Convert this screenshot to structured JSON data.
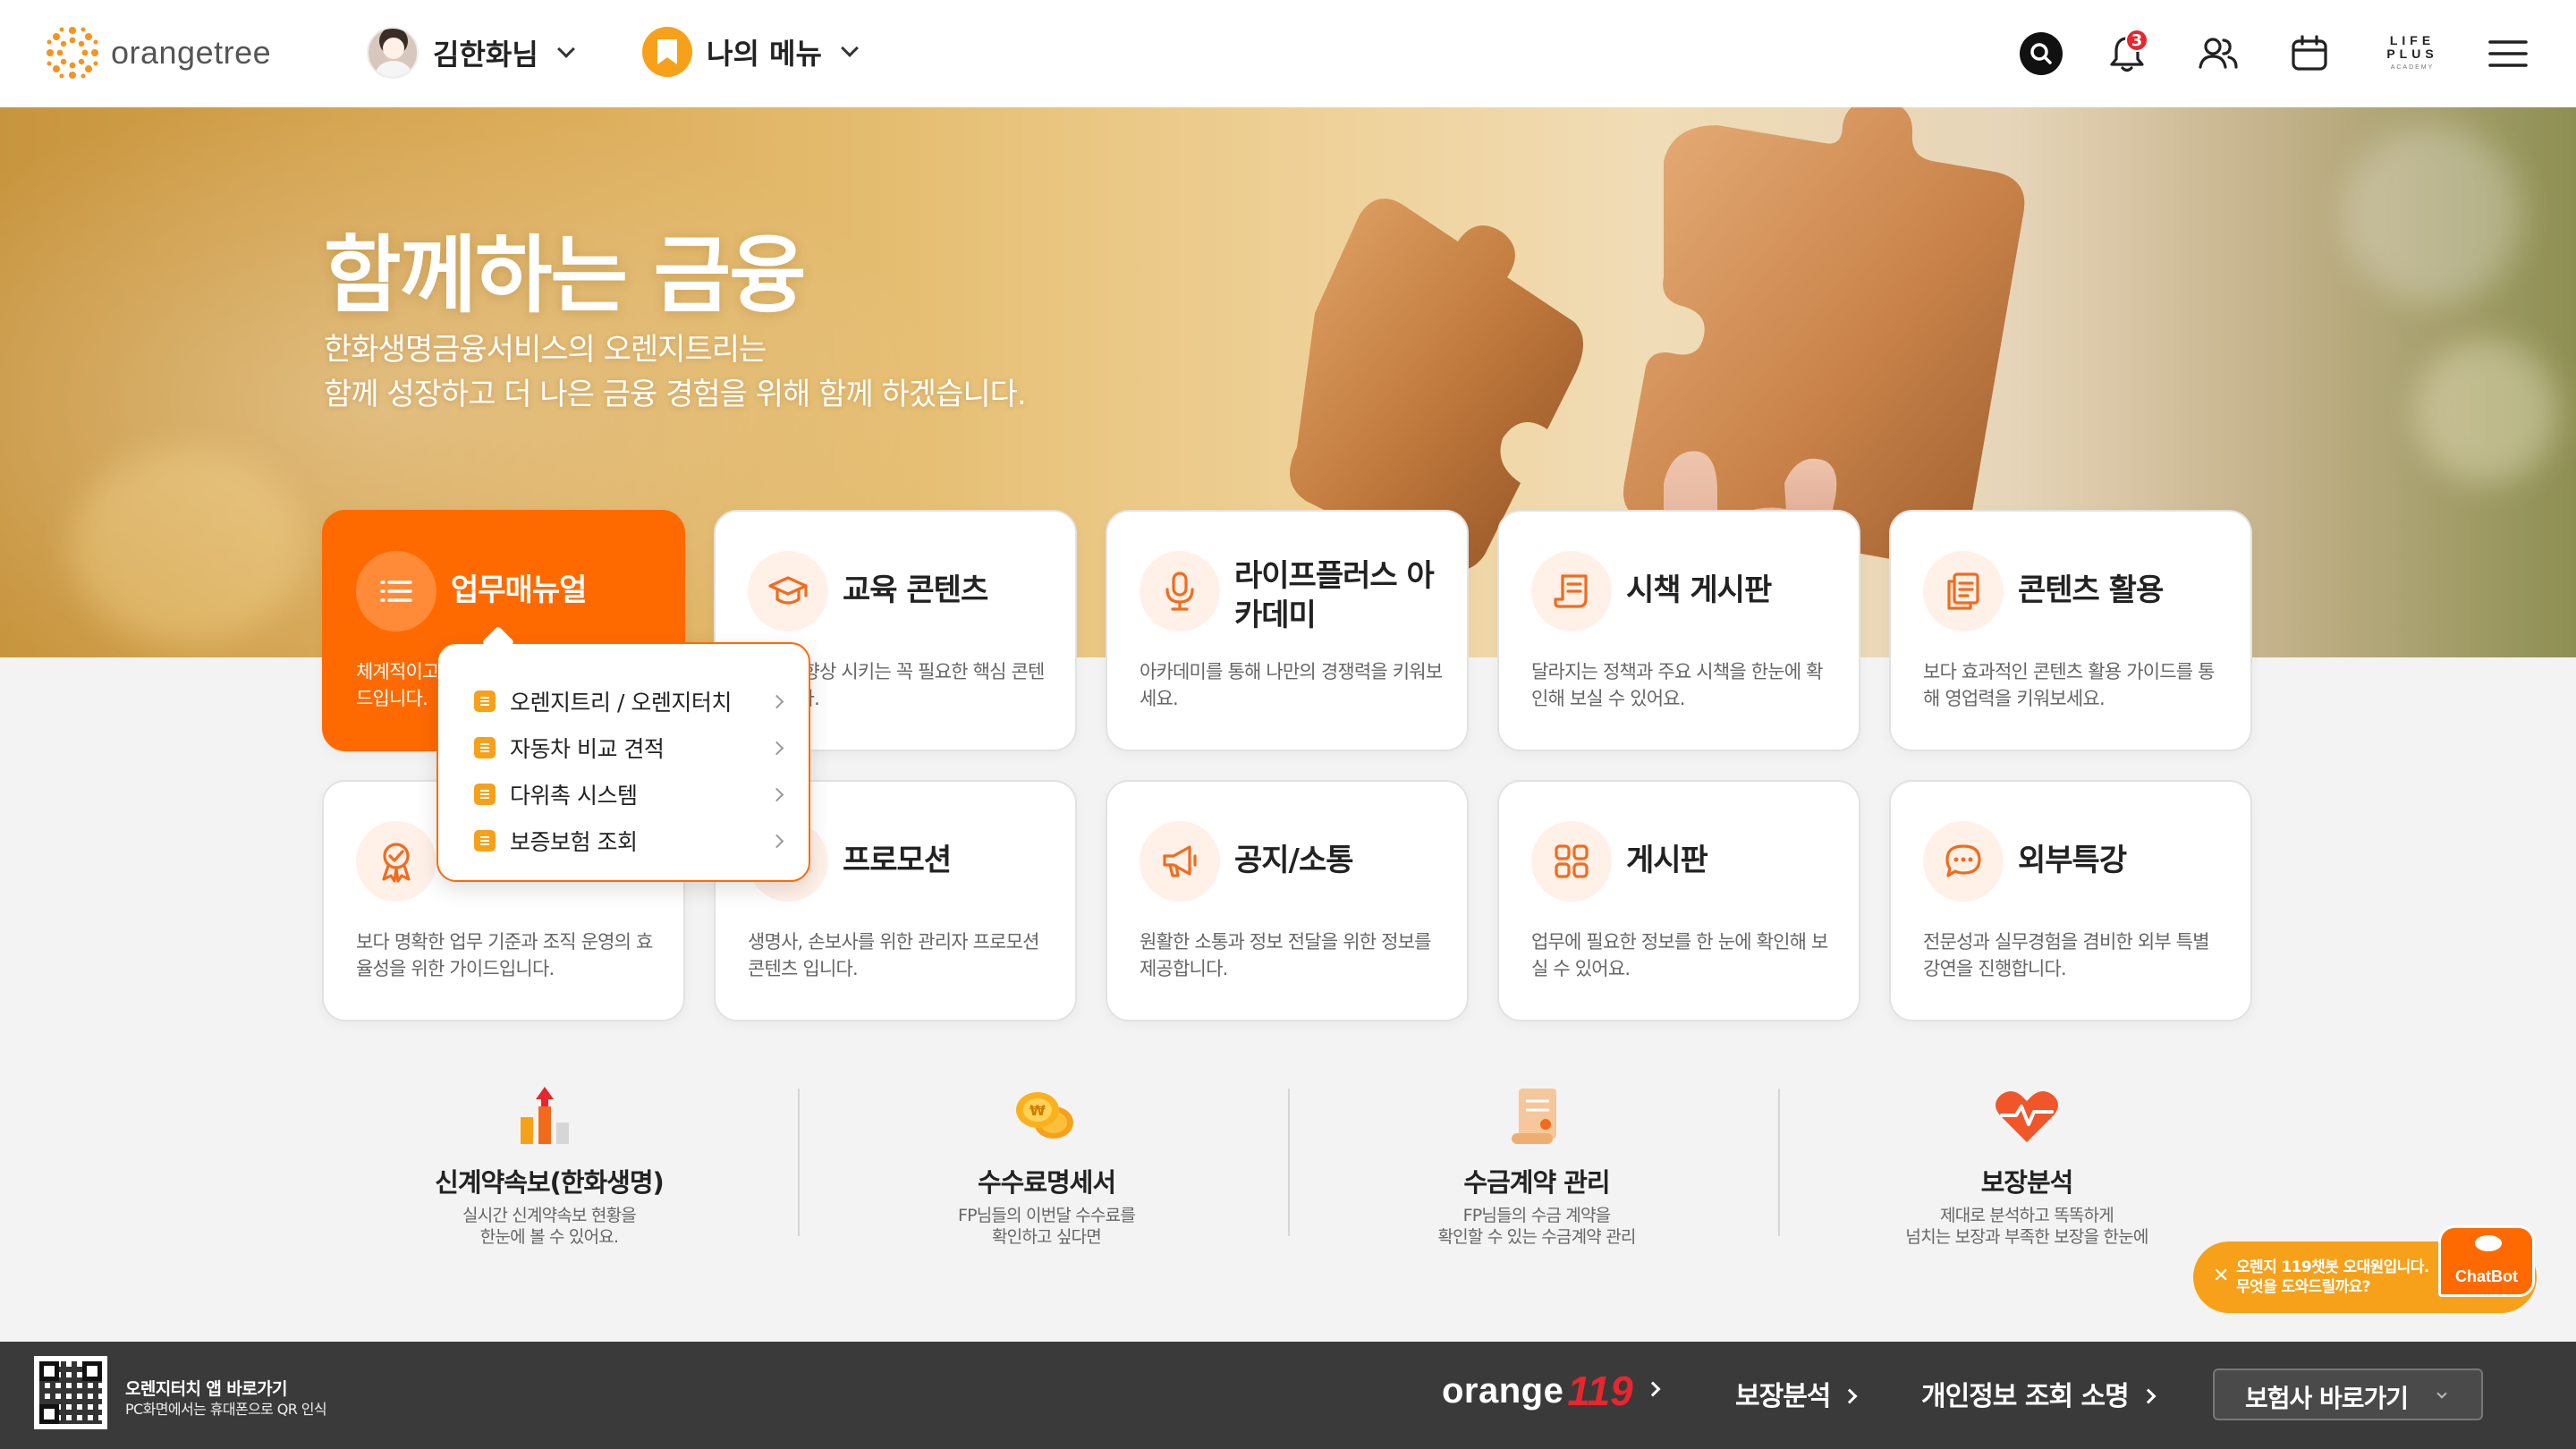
{
  "header": {
    "logo_text": "orangetree",
    "user_name": "김한화님",
    "my_menu_label": "나의 메뉴",
    "notification_count": "3",
    "lifeplus_line1": "LIFE",
    "lifeplus_line2": "PLUS",
    "lifeplus_line3": "ACADEMY",
    "icons": [
      "search-icon",
      "bell-icon",
      "users-icon",
      "calendar-icon",
      "lifeplus-logo",
      "hamburger-menu-icon"
    ]
  },
  "hero": {
    "title": "함께하는 금융",
    "subtitle_line1": "한화생명금융서비스의 오렌지트리는",
    "subtitle_line2": "함께 성장하고 더 나은 금융 경험을 위해 함께 하겠습니다."
  },
  "cards": [
    {
      "title": "업무매뉴얼",
      "desc": "체계적이고 명확한 업무를 위한 실용가이드입니다.",
      "icon": "list-icon",
      "active": true
    },
    {
      "title": "교육 콘텐츠",
      "desc": "역량을 향상 시키는 꼭 필요한 핵심 콘텐츠입니다.",
      "icon": "graduation-cap-icon"
    },
    {
      "title": "라이프플러스 아카데미",
      "desc": "아카데미를 통해 나만의 경쟁력을 키워보세요.",
      "icon": "microphone-icon"
    },
    {
      "title": "시책 게시판",
      "desc": "달라지는 정책과 주요 시책을 한눈에 확인해 보실 수 있어요.",
      "icon": "scroll-icon"
    },
    {
      "title": "콘텐츠 활용",
      "desc": "보다 효과적인 콘텐츠 활용 가이드를 통해 영업력을 키워보세요.",
      "icon": "documents-icon"
    },
    {
      "title": "",
      "desc": "보다 명확한 업무 기준과 조직 운영의 효율성을 위한 가이드입니다.",
      "icon": "badge-check-icon"
    },
    {
      "title": "프로모션",
      "desc": "생명사, 손보사를 위한 관리자 프로모션 콘텐츠 입니다.",
      "icon": "gift-icon"
    },
    {
      "title": "공지/소통",
      "desc": "원활한 소통과 정보 전달을 위한 정보를 제공합니다.",
      "icon": "megaphone-icon"
    },
    {
      "title": "게시판",
      "desc": "업무에 필요한 정보를 한 눈에 확인해 보실 수 있어요.",
      "icon": "grid-icon"
    },
    {
      "title": "외부특강",
      "desc": "전문성과 실무경험을 겸비한 외부 특별 강연을 진행합니다.",
      "icon": "chat-bubble-icon"
    }
  ],
  "dropdown": {
    "items": [
      {
        "label": "오렌지트리 / 오렌지터치"
      },
      {
        "label": "자동차 비교 견적"
      },
      {
        "label": "다위촉 시스템"
      },
      {
        "label": "보증보험 조회"
      }
    ]
  },
  "quick_links": [
    {
      "title": "신계약속보(한화생명)",
      "desc1": "실시간 신계약속보 현황을",
      "desc2": "한눈에 볼 수 있어요.",
      "icon": "bar-chart-up-icon"
    },
    {
      "title": "수수료명세서",
      "desc1": "FP님들의 이번달 수수료를",
      "desc2": "확인하고 싶다면",
      "icon": "coins-icon"
    },
    {
      "title": "수금계약 관리",
      "desc1": "FP님들의 수금 계약을",
      "desc2": "확인할 수 있는 수금계약 관리",
      "icon": "contract-scroll-icon"
    },
    {
      "title": "보장분석",
      "desc1": "제대로 분석하고 똑똑하게",
      "desc2": "넘치는 보장과 부족한 보장을 한눈에",
      "icon": "heart-pulse-icon"
    }
  ],
  "chatbot": {
    "line1": "오렌지 119챗봇 오대원입니다.",
    "line2": "무엇을 도와드릴까요?",
    "badge": "ChatBot"
  },
  "footer": {
    "app_title": "오렌지터치 앱 바로가기",
    "app_sub": "PC화면에서는 휴대폰으로 QR 인식",
    "orange_word": "orange",
    "orange_num": "119",
    "link1": "보장분석",
    "link2": "개인정보 조회 소명",
    "select_label": "보험사 바로가기"
  },
  "colors": {
    "accent": "#ff6a00",
    "accent_light": "#fff1e8",
    "yellow": "#f7a11a",
    "badge_red": "#e8262d",
    "footer_bg": "#3a3a3a"
  }
}
